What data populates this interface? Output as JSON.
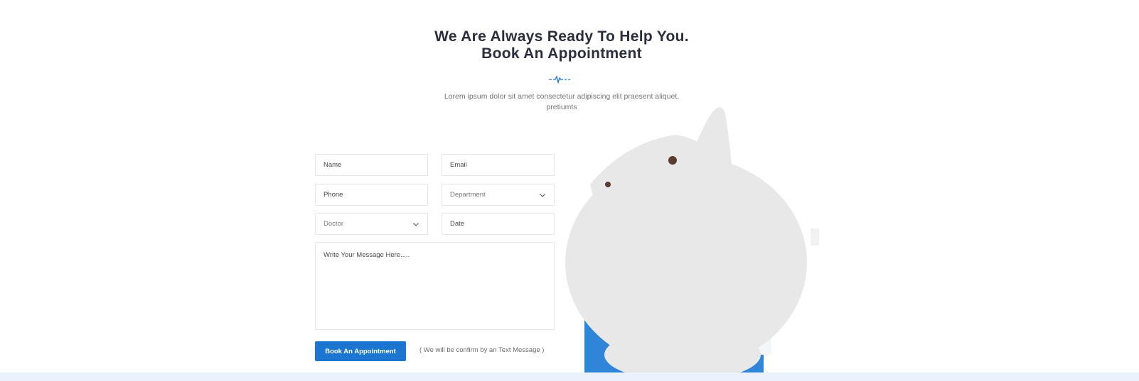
{
  "section": {
    "title_line1": "We Are Always Ready To Help You.",
    "title_line2": "Book An Appointment",
    "subtitle": "Lorem ipsum dolor sit amet consectetur adipiscing elit praesent aliquet. pretiumts"
  },
  "form": {
    "name_placeholder": "Name",
    "email_placeholder": "Email",
    "phone_placeholder": "Phone",
    "department_selected": "Department",
    "doctor_selected": "Doctor",
    "date_placeholder": "Date",
    "message_placeholder": "Write Your Message Here.....",
    "submit_label": "Book An Appointment",
    "note": "( We will be confirm by an Text Message )"
  },
  "colors": {
    "accent": "#1a76d1",
    "heading": "#2c2d3f",
    "band": "#eaf3fd"
  },
  "icons": {
    "pulse": "heartbeat-pulse-icon",
    "select_arrow": "chevron-down-icon"
  }
}
